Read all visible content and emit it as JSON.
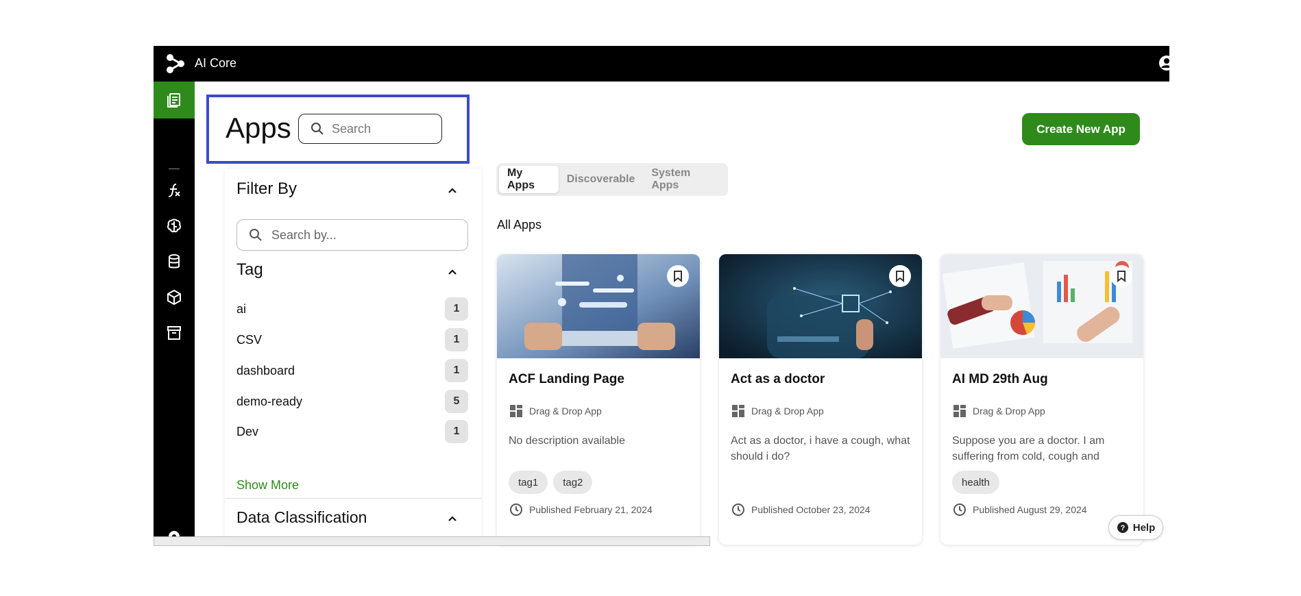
{
  "header": {
    "app_title": "AI Core"
  },
  "sidebar": {
    "items": [
      {
        "icon": "apps-icon",
        "active": true
      },
      {
        "icon": "function-icon",
        "active": false
      },
      {
        "icon": "brain-icon",
        "active": false
      },
      {
        "icon": "database-icon",
        "active": false
      },
      {
        "icon": "cube-icon",
        "active": false
      },
      {
        "icon": "archive-icon",
        "active": false
      }
    ]
  },
  "page": {
    "title": "Apps",
    "search_placeholder": "Search",
    "create_label": "Create New App"
  },
  "filter": {
    "heading": "Filter By",
    "search_placeholder": "Search by...",
    "tag_heading": "Tag",
    "tags": [
      {
        "name": "ai",
        "count": "1"
      },
      {
        "name": "CSV",
        "count": "1"
      },
      {
        "name": "dashboard",
        "count": "1"
      },
      {
        "name": "demo-ready",
        "count": "5"
      },
      {
        "name": "Dev",
        "count": "1"
      }
    ],
    "show_more": "Show More",
    "data_class_heading": "Data Classification"
  },
  "tabs": [
    {
      "label": "My Apps",
      "active": true
    },
    {
      "label": "Discoverable",
      "active": false
    },
    {
      "label": "System Apps",
      "active": false
    }
  ],
  "section_label": "All Apps",
  "cards": [
    {
      "title": "ACF Landing Page",
      "type": "Drag & Drop App",
      "description": "No description available",
      "tags": [
        "tag1",
        "tag2"
      ],
      "published": "Published February 21, 2024"
    },
    {
      "title": "Act as a doctor",
      "type": "Drag & Drop App",
      "description": "Act as a doctor, i have a cough, what should i do?",
      "tags": [],
      "published": "Published October 23, 2024"
    },
    {
      "title": "AI MD 29th Aug",
      "type": "Drag & Drop App",
      "description": "Suppose you are a doctor. I am suffering from cold, cough and",
      "tags": [
        "health"
      ],
      "published": "Published August 29, 2024"
    }
  ],
  "help_label": "Help",
  "colors": {
    "accent": "#2f8a1c",
    "topbar": "#000000",
    "highlight": "#3b4cc8"
  }
}
